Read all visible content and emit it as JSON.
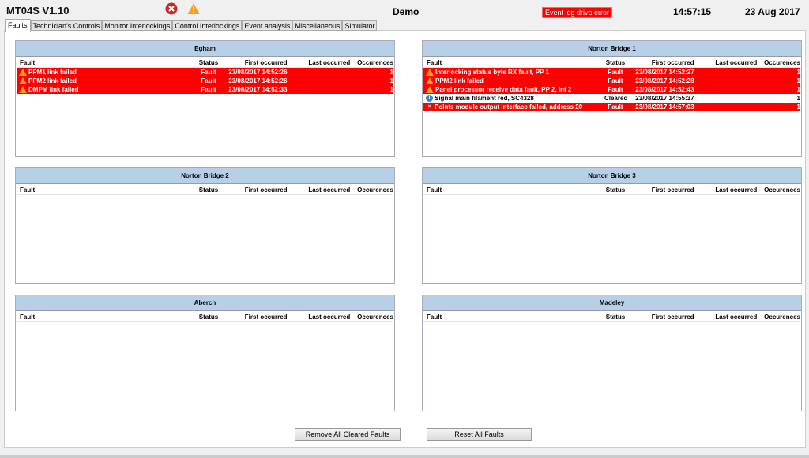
{
  "header": {
    "title": "MT04S V1.10",
    "icons": [
      "error-icon",
      "warning-icon"
    ],
    "center": "Demo",
    "error_badge": "Event log drive error",
    "time": "14:57:15",
    "date": "23 Aug 2017"
  },
  "tabs": [
    "Faults",
    "Technician's Controls",
    "Monitor Interlockings",
    "Control Interlockings",
    "Event analysis",
    "Miscellaneous",
    "Simulator"
  ],
  "columns": [
    "Fault",
    "Status",
    "First occurred",
    "Last occurred",
    "Occurences"
  ],
  "panels": [
    {
      "name": "Egham",
      "rows": [
        {
          "icon": "warn",
          "fault": "PPM1 link failed",
          "status": "Fault",
          "first": "23/08/2017 14:52:26",
          "last": "",
          "count": "1"
        },
        {
          "icon": "warn",
          "fault": "PPM2 link failed",
          "status": "Fault",
          "first": "23/08/2017 14:52:26",
          "last": "",
          "count": "1"
        },
        {
          "icon": "warn",
          "fault": "DMPM link failed",
          "status": "Fault",
          "first": "23/08/2017 14:52:33",
          "last": "",
          "count": "1"
        }
      ]
    },
    {
      "name": "Norton Bridge 1",
      "rows": [
        {
          "icon": "warn",
          "fault": "Interlocking status byte RX fault, PP 1",
          "status": "Fault",
          "first": "23/08/2017 14:52:27",
          "last": "",
          "count": "1"
        },
        {
          "icon": "warn",
          "fault": "PPM2 link failed",
          "status": "Fault",
          "first": "23/08/2017 14:52:28",
          "last": "",
          "count": "1"
        },
        {
          "icon": "warn",
          "fault": "Panel processor receive data fault, PP 2, int 2",
          "status": "Fault",
          "first": "23/08/2017 14:52:43",
          "last": "",
          "count": "1"
        },
        {
          "icon": "info",
          "fault": "Signal main filament red, SC4328",
          "status": "Cleared",
          "first": "23/08/2017 14:55:37",
          "last": "",
          "count": "1"
        },
        {
          "icon": "error",
          "fault": "Points module output interface failed, address 20",
          "status": "Fault",
          "first": "23/08/2017 14:57:03",
          "last": "",
          "count": "1"
        }
      ]
    },
    {
      "name": "Norton Bridge 2",
      "rows": []
    },
    {
      "name": "Norton Bridge 3",
      "rows": []
    },
    {
      "name": "Abercn",
      "rows": []
    },
    {
      "name": "Madeley",
      "rows": []
    }
  ],
  "buttons": {
    "remove_cleared": "Remove All Cleared Faults",
    "reset_all": "Reset All Faults"
  },
  "colors": {
    "fault_row": "#ff0000",
    "panel_header": "#b8cfe8"
  }
}
